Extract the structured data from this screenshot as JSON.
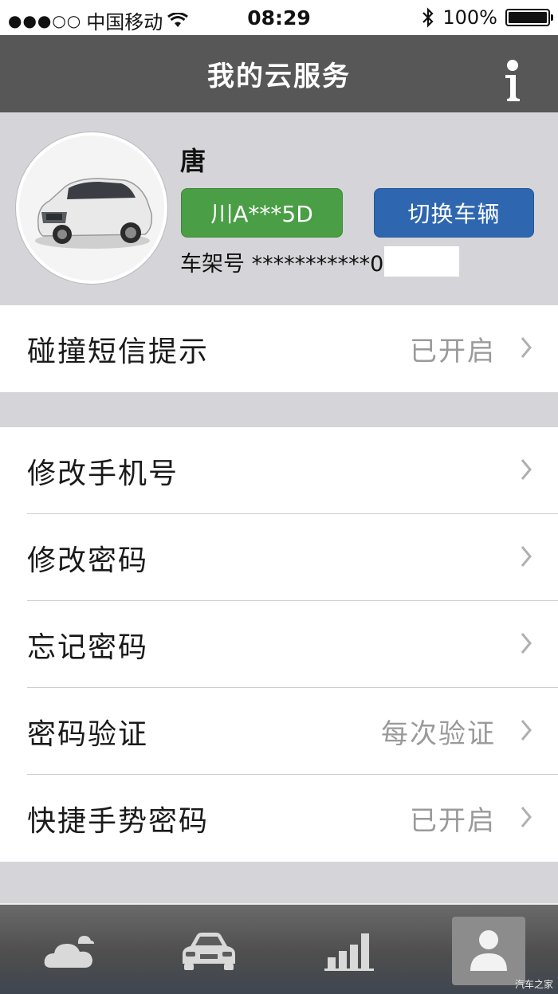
{
  "status_bar": {
    "signal_dots": "●●●○○",
    "carrier": "中国移动",
    "time": "08:29",
    "battery": "100%"
  },
  "header": {
    "title": "我的云服务"
  },
  "profile": {
    "name": "唐",
    "plate": "川A***5D",
    "switch_label": "切换车辆",
    "vin": "车架号 ***********0"
  },
  "collision_group": {
    "rows": [
      {
        "label": "碰撞短信提示",
        "value": "已开启"
      }
    ]
  },
  "settings_group": {
    "rows": [
      {
        "label": "修改手机号",
        "value": ""
      },
      {
        "label": "修改密码",
        "value": ""
      },
      {
        "label": "忘记密码",
        "value": ""
      },
      {
        "label": "密码验证",
        "value": "每次验证"
      },
      {
        "label": "快捷手势密码",
        "value": "已开启"
      }
    ]
  },
  "tabbar": {
    "tabs": [
      {
        "icon": "cloud-icon"
      },
      {
        "icon": "car-icon"
      },
      {
        "icon": "bar-chart-icon"
      },
      {
        "icon": "user-icon",
        "active": true
      }
    ],
    "watermark": "汽车之家"
  },
  "colors": {
    "nav_bg": "#575757",
    "plate_green": "#4a9e45",
    "switch_blue": "#2e66b0",
    "background_gray": "#d5d5d9"
  }
}
